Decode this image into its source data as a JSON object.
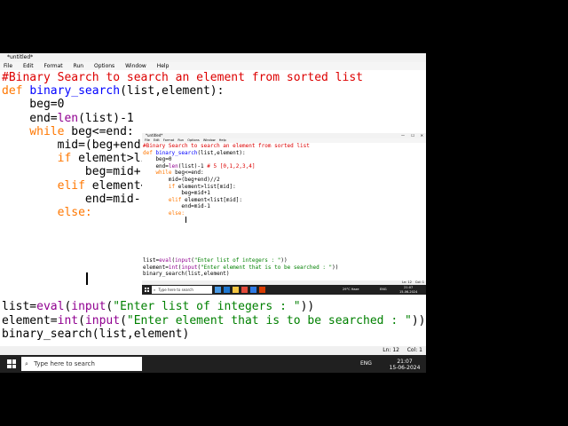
{
  "window": {
    "title": "*untitled*",
    "menu": [
      "File",
      "Edit",
      "Format",
      "Run",
      "Options",
      "Window",
      "Help"
    ],
    "controls": {
      "min": "—",
      "max": "☐",
      "close": "✕"
    }
  },
  "code": {
    "l1": "#Binary Search to search an element from sorted list",
    "l2_kw": "def",
    "l2_fn": "binary_search",
    "l2_rest": "(list,element):",
    "l3": "    beg=0",
    "l4_a": "    end=",
    "l4_b": "len",
    "l4_c": "(list)-1",
    "l4_d": " # 5 [0,1,2,3,4]",
    "l5_kw": "    while",
    "l5_rest": " beg<=end:",
    "l6": "        mid=(beg+end)//2",
    "l7_kw": "        if",
    "l7_rest": " element>list[mid]:",
    "l8": "            beg=mid+1",
    "l9_kw": "        elif",
    "l9_rest": " element<list[mid]:",
    "l10": "            end=mid-1",
    "l11_kw": "        else:",
    "l12_a": "list=",
    "l12_b": "eval",
    "l12_c": "(",
    "l12_d": "input",
    "l12_e": "(",
    "l12_f": "\"Enter list of integers : \"",
    "l12_g": "))",
    "l13_a": "element=",
    "l13_b": "int",
    "l13_c": "(",
    "l13_d": "input",
    "l13_e": "(",
    "l13_f": "\"Enter element that is to be searched : \"",
    "l13_g": "))",
    "l14": "binary_search(list,element)"
  },
  "status": {
    "ln": "Ln: 12",
    "col": "Col: 1"
  },
  "taskbar": {
    "search_placeholder": "Type here to search",
    "weather": "29°C Haze",
    "lang": "ENG",
    "time": "21:07",
    "date": "15-06-2024"
  },
  "colors": {
    "keyword": "#ff7700",
    "function": "#0000ff",
    "string": "#008000",
    "comment": "#dd0000",
    "builtin": "#900090"
  }
}
